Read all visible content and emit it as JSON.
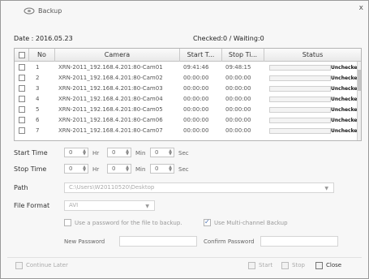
{
  "window": {
    "title": "Backup",
    "close_glyph": "x"
  },
  "header": {
    "date": "Date : 2016.05.23",
    "checked": "Checked:0 / Waiting:0"
  },
  "table": {
    "columns": [
      "No",
      "Camera",
      "Start T...",
      "Stop Ti...",
      "Status"
    ],
    "rows": [
      {
        "no": "1",
        "camera": "XRN-2011_192.168.4.201:80-Cam01",
        "start": "09:41:46",
        "stop": "09:48:15",
        "status": "Unchecked"
      },
      {
        "no": "2",
        "camera": "XRN-2011_192.168.4.201:80-Cam02",
        "start": "00:00:00",
        "stop": "00:00:00",
        "status": "Unchecked"
      },
      {
        "no": "3",
        "camera": "XRN-2011_192.168.4.201:80-Cam03",
        "start": "00:00:00",
        "stop": "00:00:00",
        "status": "Unchecked"
      },
      {
        "no": "4",
        "camera": "XRN-2011_192.168.4.201:80-Cam04",
        "start": "00:00:00",
        "stop": "00:00:00",
        "status": "Unchecked"
      },
      {
        "no": "5",
        "camera": "XRN-2011_192.168.4.201:80-Cam05",
        "start": "00:00:00",
        "stop": "00:00:00",
        "status": "Unchecked"
      },
      {
        "no": "6",
        "camera": "XRN-2011_192.168.4.201:80-Cam06",
        "start": "00:00:00",
        "stop": "00:00:00",
        "status": "Unchecked"
      },
      {
        "no": "7",
        "camera": "XRN-2011_192.168.4.201:80-Cam07",
        "start": "00:00:00",
        "stop": "00:00:00",
        "status": "Unchecked"
      }
    ]
  },
  "form": {
    "start_time_label": "Start Time",
    "stop_time_label": "Stop Time",
    "path_label": "Path",
    "file_format_label": "File Format",
    "start": {
      "hr": "0",
      "min": "0",
      "sec": "0"
    },
    "stop": {
      "hr": "0",
      "min": "0",
      "sec": "0"
    },
    "unit_hr": "Hr",
    "unit_min": "Min",
    "unit_sec": "Sec",
    "path_value": "C:\\Users\\W20110520\\Desktop",
    "file_format_value": "AVI",
    "use_password_label": "Use a password for the file to backup.",
    "use_multichannel_label": "Use Multi-channel Backup",
    "use_password_checked": false,
    "use_multichannel_checked": true,
    "new_password_label": "New Password",
    "confirm_password_label": "Confirm Password"
  },
  "buttons": {
    "continue_later": "Continue Later",
    "start": "Start",
    "stop": "Stop",
    "close": "Close"
  },
  "colors": {
    "accent": "#4a6fb1"
  }
}
